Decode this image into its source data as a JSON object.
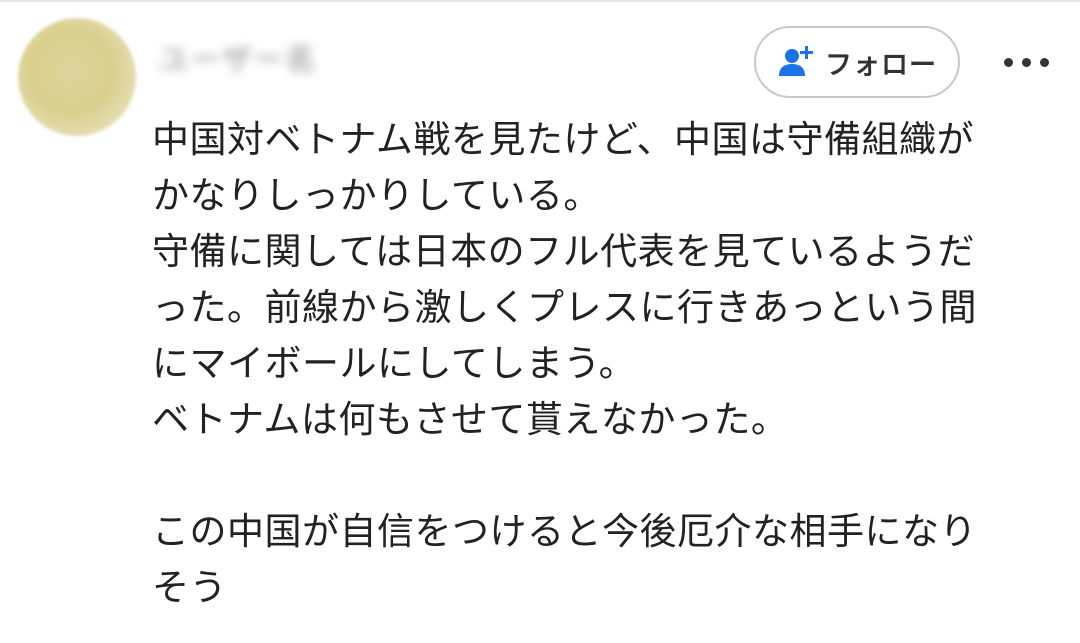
{
  "post": {
    "username": "ユーザー名",
    "follow_label": "フォロー",
    "follow_icon": "add-user-icon",
    "more_icon": "more-horizontal-icon",
    "avatar_color": "#ddd29a",
    "accent_color": "#1a73e8",
    "comment_lines": [
      "中国対ベトナム戦を見たけど、中国は守備組織が",
      "かなりしっかりしている。",
      "守備に関しては日本のフル代表を見ているようだ",
      "った。前線から激しくプレスに行きあっという間",
      "にマイボールにしてしまう。",
      "ベトナムは何もさせて貰えなかった。",
      "",
      "この中国が自信をつけると今後厄介な相手になり",
      "そう"
    ]
  }
}
